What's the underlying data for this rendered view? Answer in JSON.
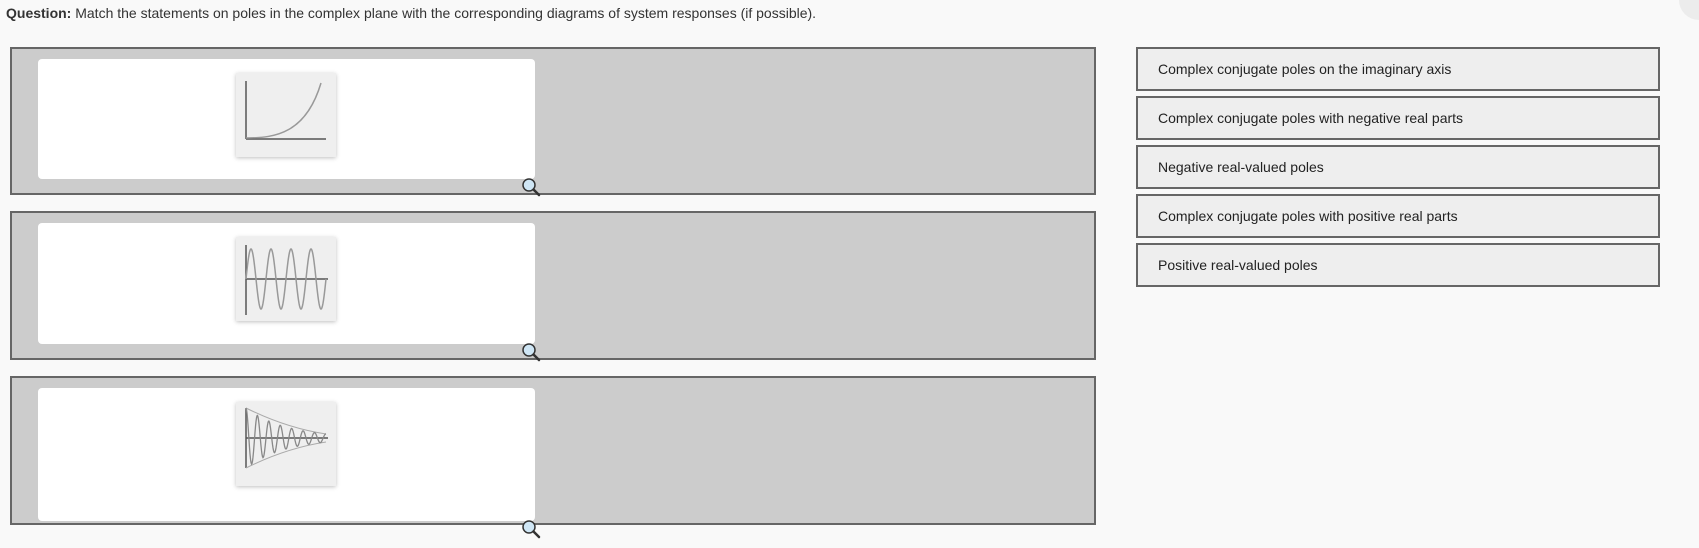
{
  "question": {
    "label": "Question:",
    "text": "Match the statements on poles in the complex plane with the corresponding diagrams of system responses (if possible)."
  },
  "drop_zones": [
    {
      "diagram": "growing-exponential-icon"
    },
    {
      "diagram": "sustained-oscillation-icon"
    },
    {
      "diagram": "damped-oscillation-icon"
    }
  ],
  "answers": [
    {
      "label": "Complex conjugate poles on the imaginary axis"
    },
    {
      "label": "Complex conjugate poles with negative real parts"
    },
    {
      "label": "Negative real-valued poles"
    },
    {
      "label": "Complex conjugate poles with positive real parts"
    },
    {
      "label": "Positive real-valued poles"
    }
  ],
  "colors": {
    "zone_bg": "#cccccc",
    "zone_border": "#666666",
    "answer_bg": "#eeeeee",
    "page_bg": "#f9f9f9"
  }
}
